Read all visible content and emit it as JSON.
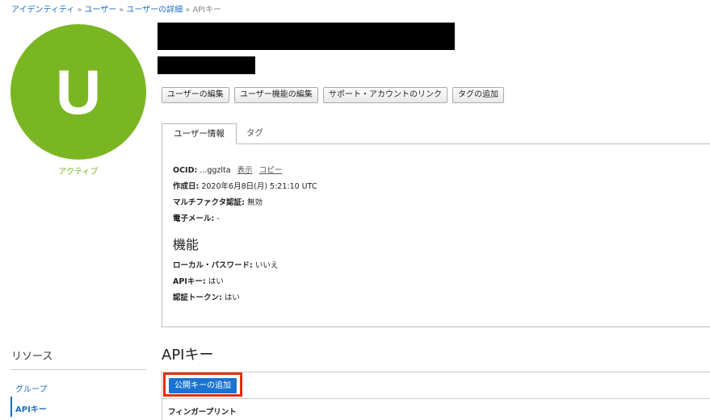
{
  "breadcrumb": {
    "items": [
      "アイデンティティ",
      "ユーザー",
      "ユーザーの詳細",
      "APIキー"
    ],
    "separator": "»"
  },
  "user": {
    "avatar_letter": "U",
    "status": "アクティブ",
    "avatar_color": "#7ab623"
  },
  "actions": {
    "edit_user": "ユーザーの編集",
    "edit_capabilities": "ユーザー機能の編集",
    "link_support_account": "サポート・アカウントのリンク",
    "add_tags": "タグの追加"
  },
  "tabs": {
    "user_info": "ユーザー情報",
    "tags": "タグ"
  },
  "info": {
    "ocid_label": "OCID:",
    "ocid_value": "...ggzlta",
    "show_link": "表示",
    "copy_link": "コピー",
    "created_label": "作成日:",
    "created_value": "2020年6月8日(月) 5:21:10 UTC",
    "mfa_label": "マルチファクタ認証:",
    "mfa_value": "無効",
    "email_label": "電子メール:",
    "email_value": "-"
  },
  "capabilities": {
    "title": "機能",
    "local_password_label": "ローカル・パスワード:",
    "local_password_value": "いいえ",
    "api_key_label": "APIキー:",
    "api_key_value": "はい",
    "auth_token_label": "認証トークン:",
    "auth_token_value": "はい"
  },
  "resources": {
    "title": "リソース",
    "items": [
      "グループ",
      "APIキー"
    ],
    "active_index": 1
  },
  "api_keys": {
    "title": "APIキー",
    "add_button": "公開キーの追加",
    "column_fingerprint": "フィンガープリント"
  },
  "colors": {
    "link": "#1b6fc4",
    "primary_button": "#1a73d2",
    "highlight": "#e62e0f",
    "active_status": "#7ab623"
  }
}
